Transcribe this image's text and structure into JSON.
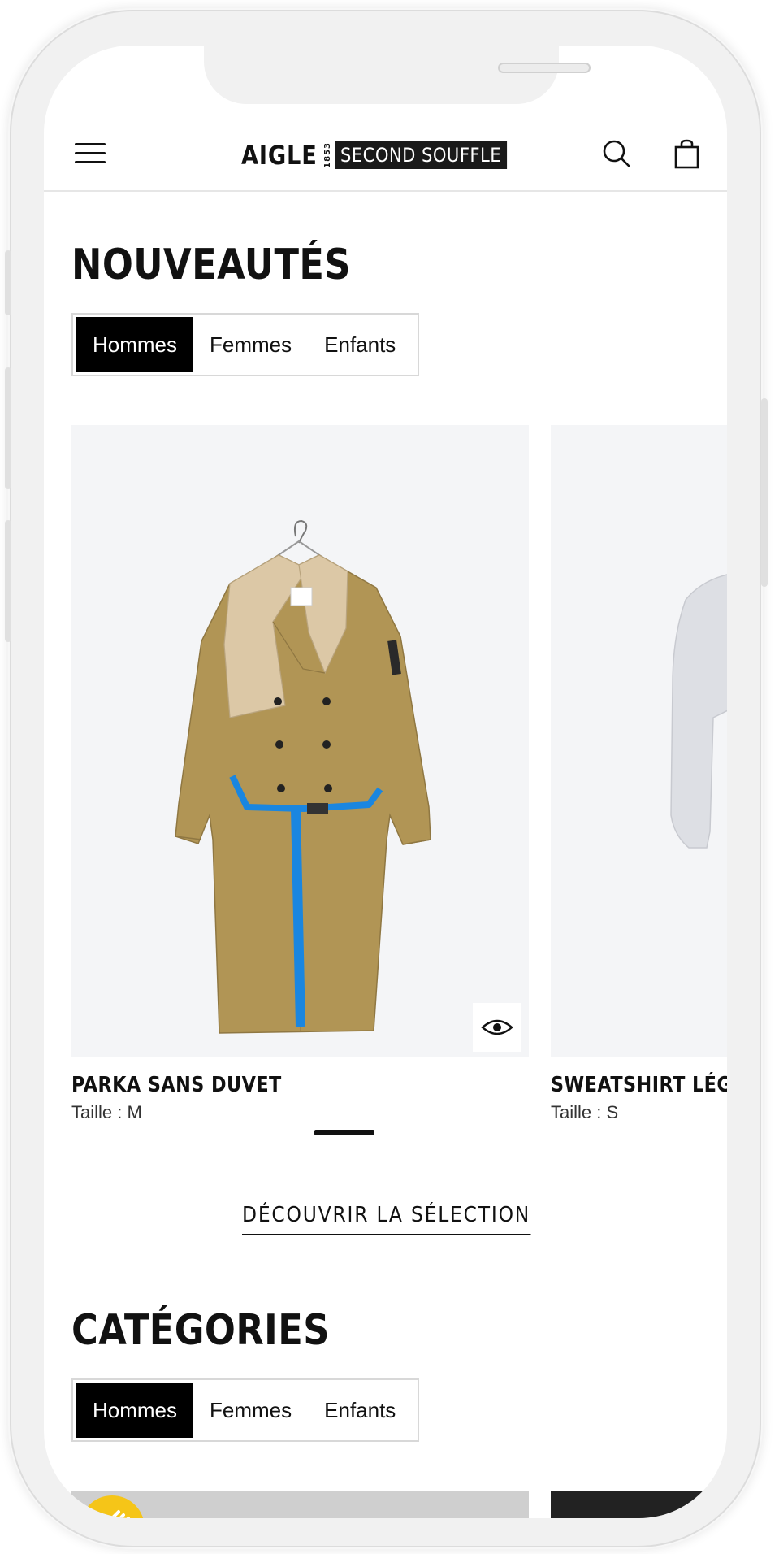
{
  "header": {
    "logo_brand": "AIGLE",
    "logo_year": "1853",
    "logo_tagline": "SECOND SOUFFLE",
    "menu_icon": "hamburger-menu-icon",
    "search_icon": "search-icon",
    "cart_icon": "shopping-bag-icon"
  },
  "nouveautes": {
    "title": "NOUVEAUTÉS",
    "tabs": [
      {
        "label": "Hommes",
        "active": true
      },
      {
        "label": "Femmes",
        "active": false
      },
      {
        "label": "Enfants",
        "active": false
      }
    ],
    "products": [
      {
        "name": "PARKA SANS DUVET",
        "size": "Taille : M",
        "quick_view_icon": "eye-icon"
      },
      {
        "name": "SWEATSHIRT LÉGER",
        "size": "Taille : S"
      }
    ],
    "cta": "DÉCOUVRIR LA SÉLECTION"
  },
  "categories": {
    "title": "CATÉGORIES",
    "tabs": [
      {
        "label": "Hommes",
        "active": true
      },
      {
        "label": "Femmes",
        "active": false
      },
      {
        "label": "Enfants",
        "active": false
      }
    ]
  },
  "colors": {
    "accent_blue": "#1a86e0",
    "black": "#000000",
    "coat_khaki": "#b19555",
    "coat_beige": "#dcc8a6"
  }
}
